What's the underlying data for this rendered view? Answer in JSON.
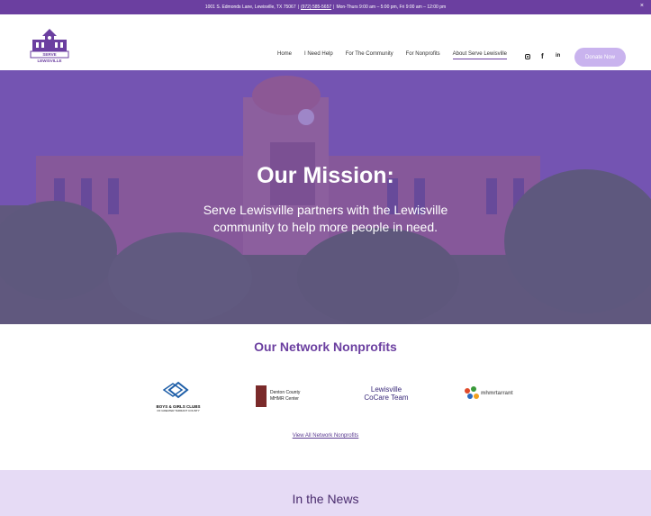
{
  "topbar": {
    "address": "1001 S. Edmonds Lane, Lewisville, TX 75067",
    "phone": "(972) 585-5657",
    "hours": "Mon-Thurs 9:00 am – 5:00 pm, Fri 9:00 am – 12:00 pm",
    "separator": "|",
    "close": "×"
  },
  "logo": {
    "text": "SERVE LEWISVILLE",
    "color": "#6b3fa0"
  },
  "nav": {
    "items": [
      "Home",
      "I Need Help",
      "For The Community",
      "For Nonprofits",
      "About Serve Lewisville"
    ],
    "active_index": 4
  },
  "social": [
    "instagram-icon",
    "facebook-icon",
    "linkedin-icon"
  ],
  "donate": {
    "label": "Donate Now"
  },
  "hero": {
    "title": "Our Mission:",
    "text": "Serve Lewisville partners with the Lewisville community to help more people in need."
  },
  "network": {
    "title": "Our Network Nonprofits",
    "partners": [
      {
        "name": "BOYS & GIRLS CLUBS",
        "sub": "OF GREATER TARRANT COUNTY"
      },
      {
        "name": "Denton County",
        "sub": "MHMR Center"
      },
      {
        "name": "Lewisville",
        "sub": "CoCare Team"
      },
      {
        "name": "mhmrtarrant",
        "sub": ""
      }
    ],
    "view_all": "View All Network Nonprofits"
  },
  "news": {
    "title": "In the News"
  },
  "colors": {
    "brand": "#6b3fa0",
    "donate": "#c9b3ee",
    "news_bg": "#e6dbf5"
  }
}
